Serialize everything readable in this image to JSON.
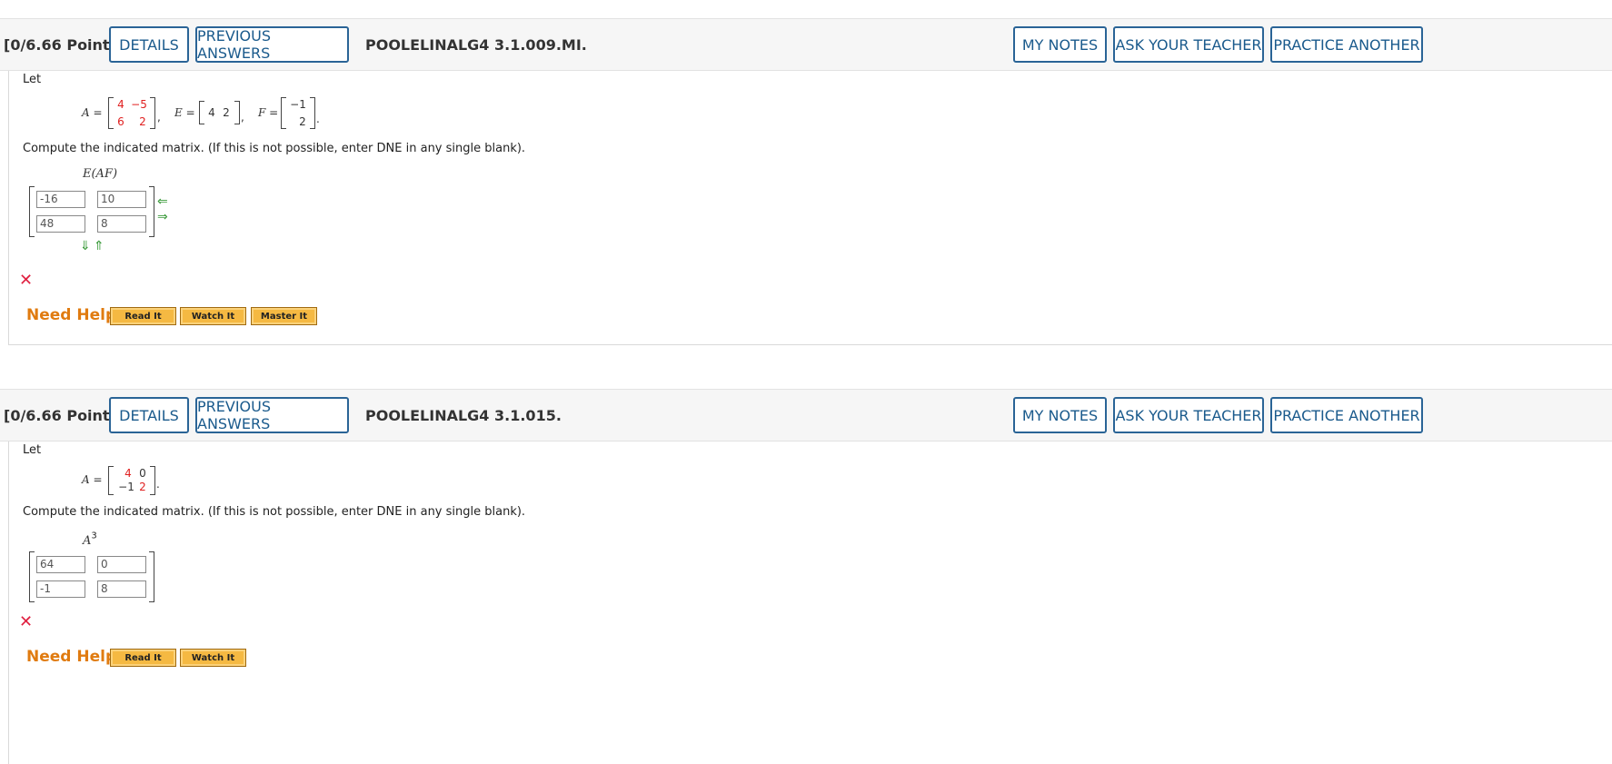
{
  "q1": {
    "points": "[0/6.66 Points]",
    "details": "DETAILS",
    "previous_answers": "PREVIOUS ANSWERS",
    "qid": "POOLELINALG4 3.1.009.MI.",
    "my_notes": "MY NOTES",
    "ask_teacher": "ASK YOUR TEACHER",
    "practice_another": "PRACTICE ANOTHER",
    "let": "Let",
    "A_label": "A =",
    "A": [
      [
        "4",
        "−5"
      ],
      [
        "6",
        "2"
      ]
    ],
    "E_label": "E =",
    "E": [
      "4",
      "2"
    ],
    "F_label": "F =",
    "F": [
      "−1",
      "2"
    ],
    "prompt": "Compute the indicated matrix. (If this is not possible, enter DNE in any single blank).",
    "expr": "E(AF)",
    "answers": [
      [
        "-16",
        "10"
      ],
      [
        "48",
        "8"
      ]
    ],
    "status_icon": "x-icon",
    "need_help": "Need Help?",
    "read_it": "Read It",
    "watch_it": "Watch It",
    "master_it": "Master It"
  },
  "q2": {
    "points": "[0/6.66 Points]",
    "details": "DETAILS",
    "previous_answers": "PREVIOUS ANSWERS",
    "qid": "POOLELINALG4 3.1.015.",
    "my_notes": "MY NOTES",
    "ask_teacher": "ASK YOUR TEACHER",
    "practice_another": "PRACTICE ANOTHER",
    "let": "Let",
    "A_label": "A =",
    "A": [
      [
        "4",
        "0"
      ],
      [
        "−1",
        "2"
      ]
    ],
    "prompt": "Compute the indicated matrix. (If this is not possible, enter DNE in any single blank).",
    "expr": "A",
    "expr_sup": "3",
    "answers": [
      [
        "64",
        "0"
      ],
      [
        "-1",
        "8"
      ]
    ],
    "status_icon": "x-icon",
    "need_help": "Need Help?",
    "read_it": "Read It",
    "watch_it": "Watch It"
  },
  "colors": {
    "accent": "#1a5a8c",
    "help": "#e07b10",
    "error": "#e02040",
    "matrix_highlight": "#e02020"
  }
}
